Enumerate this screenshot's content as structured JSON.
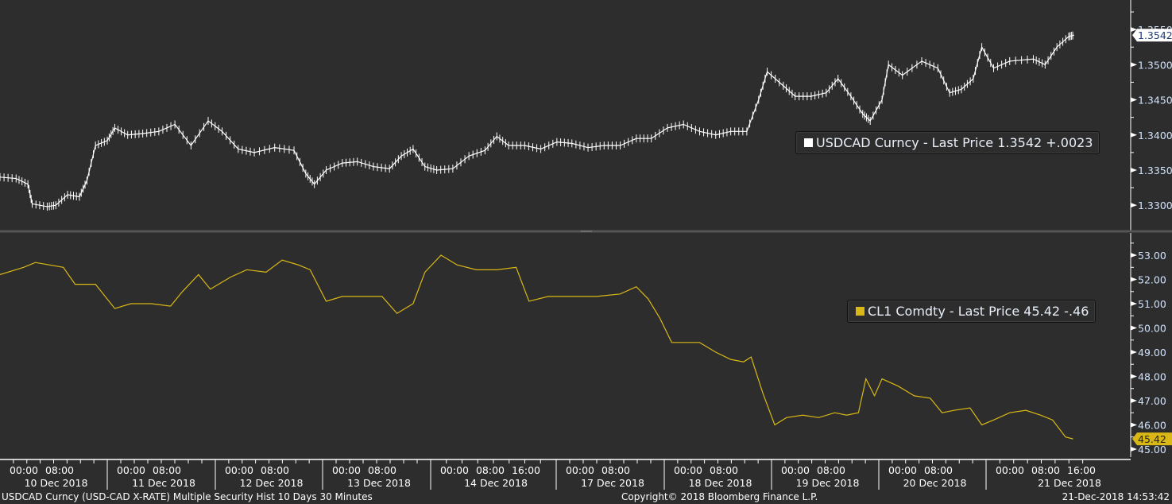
{
  "colors": {
    "background": "#2d2d2d",
    "usdcad": "#ffffff",
    "cl1": "#d9b815",
    "axis_label": "#cfe3ff"
  },
  "legends": {
    "usdcad": "USDCAD Curncy - Last Price 1.3542  +.0023",
    "cl1": "CL1 Comdty - Last Price 45.42  -.46"
  },
  "footer": {
    "left": "USDCAD Curncy (USD-CAD X-RATE) Multiple Security Hist   10 Days 30 Minutes",
    "center": "Copyright© 2018 Bloomberg Finance L.P.",
    "right": "21-Dec-2018 14:53:42"
  },
  "chart_data": [
    {
      "type": "line",
      "title": "USDCAD Curncy - Last Price",
      "last_label": "1.3542",
      "x_unit": "trading days from start",
      "xlim": [
        0,
        10.53
      ],
      "ylim": [
        1.3264,
        1.3592
      ],
      "yticks": [
        "1.3300",
        "1.3350",
        "1.3400",
        "1.3450",
        "1.3500",
        "1.3550"
      ],
      "points": [
        [
          0,
          1.334
        ],
        [
          0.15,
          1.3338
        ],
        [
          0.26,
          1.333
        ],
        [
          0.3,
          1.3302
        ],
        [
          0.44,
          1.3298
        ],
        [
          0.52,
          1.33
        ],
        [
          0.63,
          1.3315
        ],
        [
          0.74,
          1.3312
        ],
        [
          0.81,
          1.3335
        ],
        [
          0.89,
          1.3385
        ],
        [
          1.0,
          1.3392
        ],
        [
          1.07,
          1.341
        ],
        [
          1.19,
          1.34
        ],
        [
          1.33,
          1.3402
        ],
        [
          1.48,
          1.3405
        ],
        [
          1.63,
          1.3415
        ],
        [
          1.78,
          1.3385
        ],
        [
          1.94,
          1.342
        ],
        [
          2.07,
          1.3405
        ],
        [
          2.22,
          1.338
        ],
        [
          2.37,
          1.3375
        ],
        [
          2.56,
          1.3382
        ],
        [
          2.74,
          1.3378
        ],
        [
          2.85,
          1.3345
        ],
        [
          2.93,
          1.333
        ],
        [
          3.04,
          1.335
        ],
        [
          3.19,
          1.336
        ],
        [
          3.33,
          1.3362
        ],
        [
          3.48,
          1.3355
        ],
        [
          3.63,
          1.3352
        ],
        [
          3.74,
          1.337
        ],
        [
          3.85,
          1.338
        ],
        [
          3.96,
          1.3355
        ],
        [
          4.07,
          1.335
        ],
        [
          4.22,
          1.3352
        ],
        [
          4.37,
          1.337
        ],
        [
          4.52,
          1.3378
        ],
        [
          4.63,
          1.3398
        ],
        [
          4.74,
          1.3385
        ],
        [
          4.89,
          1.3385
        ],
        [
          5.04,
          1.338
        ],
        [
          5.19,
          1.339
        ],
        [
          5.33,
          1.3388
        ],
        [
          5.48,
          1.3382
        ],
        [
          5.63,
          1.3385
        ],
        [
          5.78,
          1.3385
        ],
        [
          5.93,
          1.3395
        ],
        [
          6.07,
          1.3395
        ],
        [
          6.22,
          1.341
        ],
        [
          6.37,
          1.3415
        ],
        [
          6.52,
          1.3405
        ],
        [
          6.67,
          1.34
        ],
        [
          6.81,
          1.3405
        ],
        [
          6.96,
          1.3405
        ],
        [
          7.07,
          1.345
        ],
        [
          7.15,
          1.349
        ],
        [
          7.3,
          1.347
        ],
        [
          7.41,
          1.3455
        ],
        [
          7.56,
          1.3455
        ],
        [
          7.7,
          1.346
        ],
        [
          7.81,
          1.348
        ],
        [
          7.93,
          1.3455
        ],
        [
          8.04,
          1.343
        ],
        [
          8.11,
          1.342
        ],
        [
          8.22,
          1.345
        ],
        [
          8.28,
          1.35
        ],
        [
          8.41,
          1.3485
        ],
        [
          8.59,
          1.3505
        ],
        [
          8.74,
          1.3495
        ],
        [
          8.85,
          1.346
        ],
        [
          8.96,
          1.3465
        ],
        [
          9.07,
          1.348
        ],
        [
          9.15,
          1.3525
        ],
        [
          9.26,
          1.3495
        ],
        [
          9.41,
          1.3505
        ],
        [
          9.63,
          1.3508
        ],
        [
          9.74,
          1.35
        ],
        [
          9.85,
          1.3525
        ],
        [
          9.96,
          1.354
        ],
        [
          10.01,
          1.3542
        ]
      ]
    },
    {
      "type": "line",
      "title": "CL1 Comdty - Last Price",
      "last_label": "45.42",
      "x_unit": "trading days from start",
      "xlim": [
        0,
        10.53
      ],
      "ylim": [
        44.67,
        53.92
      ],
      "yticks": [
        "45.00",
        "46.00",
        "47.00",
        "48.00",
        "49.00",
        "50.00",
        "51.00",
        "52.00",
        "53.00"
      ],
      "points": [
        [
          0,
          52.2
        ],
        [
          0.22,
          52.5
        ],
        [
          0.33,
          52.7
        ],
        [
          0.59,
          52.5
        ],
        [
          0.7,
          51.8
        ],
        [
          0.89,
          51.8
        ],
        [
          1.07,
          50.8
        ],
        [
          1.22,
          51.0
        ],
        [
          1.41,
          51.0
        ],
        [
          1.59,
          50.9
        ],
        [
          1.7,
          51.5
        ],
        [
          1.85,
          52.2
        ],
        [
          1.96,
          51.6
        ],
        [
          2.15,
          52.1
        ],
        [
          2.3,
          52.4
        ],
        [
          2.48,
          52.3
        ],
        [
          2.63,
          52.8
        ],
        [
          2.78,
          52.6
        ],
        [
          2.89,
          52.4
        ],
        [
          3.04,
          51.1
        ],
        [
          3.19,
          51.3
        ],
        [
          3.33,
          51.3
        ],
        [
          3.56,
          51.3
        ],
        [
          3.7,
          50.6
        ],
        [
          3.85,
          51.0
        ],
        [
          3.96,
          52.3
        ],
        [
          4.11,
          53.0
        ],
        [
          4.26,
          52.6
        ],
        [
          4.44,
          52.4
        ],
        [
          4.63,
          52.4
        ],
        [
          4.81,
          52.5
        ],
        [
          4.93,
          51.1
        ],
        [
          5.11,
          51.3
        ],
        [
          5.33,
          51.3
        ],
        [
          5.56,
          51.3
        ],
        [
          5.78,
          51.4
        ],
        [
          5.93,
          51.7
        ],
        [
          6.04,
          51.2
        ],
        [
          6.15,
          50.4
        ],
        [
          6.26,
          49.4
        ],
        [
          6.41,
          49.4
        ],
        [
          6.52,
          49.4
        ],
        [
          6.67,
          49.0
        ],
        [
          6.81,
          48.7
        ],
        [
          6.93,
          48.6
        ],
        [
          7.0,
          48.8
        ],
        [
          7.11,
          47.3
        ],
        [
          7.22,
          46.0
        ],
        [
          7.33,
          46.3
        ],
        [
          7.48,
          46.4
        ],
        [
          7.63,
          46.3
        ],
        [
          7.78,
          46.5
        ],
        [
          7.89,
          46.4
        ],
        [
          8.0,
          46.5
        ],
        [
          8.07,
          47.9
        ],
        [
          8.15,
          47.2
        ],
        [
          8.22,
          47.9
        ],
        [
          8.37,
          47.6
        ],
        [
          8.52,
          47.2
        ],
        [
          8.67,
          47.1
        ],
        [
          8.78,
          46.5
        ],
        [
          8.89,
          46.6
        ],
        [
          9.04,
          46.7
        ],
        [
          9.15,
          46.0
        ],
        [
          9.26,
          46.2
        ],
        [
          9.41,
          46.5
        ],
        [
          9.56,
          46.6
        ],
        [
          9.7,
          46.4
        ],
        [
          9.81,
          46.2
        ],
        [
          9.93,
          45.5
        ],
        [
          10.0,
          45.42
        ]
      ]
    }
  ],
  "x_axis": {
    "days": [
      {
        "date": "10 Dec 2018",
        "times": [
          "00:00",
          "08:00"
        ]
      },
      {
        "date": "11 Dec 2018",
        "times": [
          "00:00",
          "08:00"
        ]
      },
      {
        "date": "12 Dec 2018",
        "times": [
          "00:00",
          "08:00"
        ]
      },
      {
        "date": "13 Dec 2018",
        "times": [
          "00:00",
          "08:00"
        ]
      },
      {
        "date": "14 Dec 2018",
        "times": [
          "00:00",
          "08:00",
          "16:00"
        ]
      },
      {
        "date": "17 Dec 2018",
        "times": [
          "00:00",
          "08:00"
        ]
      },
      {
        "date": "18 Dec 2018",
        "times": [
          "00:00",
          "08:00"
        ]
      },
      {
        "date": "19 Dec 2018",
        "times": [
          "00:00",
          "08:00"
        ]
      },
      {
        "date": "20 Dec 2018",
        "times": [
          "00:00",
          "08:00"
        ]
      },
      {
        "date": "21 Dec 2018",
        "times": [
          "00:00",
          "08:00",
          "16:00"
        ]
      }
    ]
  }
}
